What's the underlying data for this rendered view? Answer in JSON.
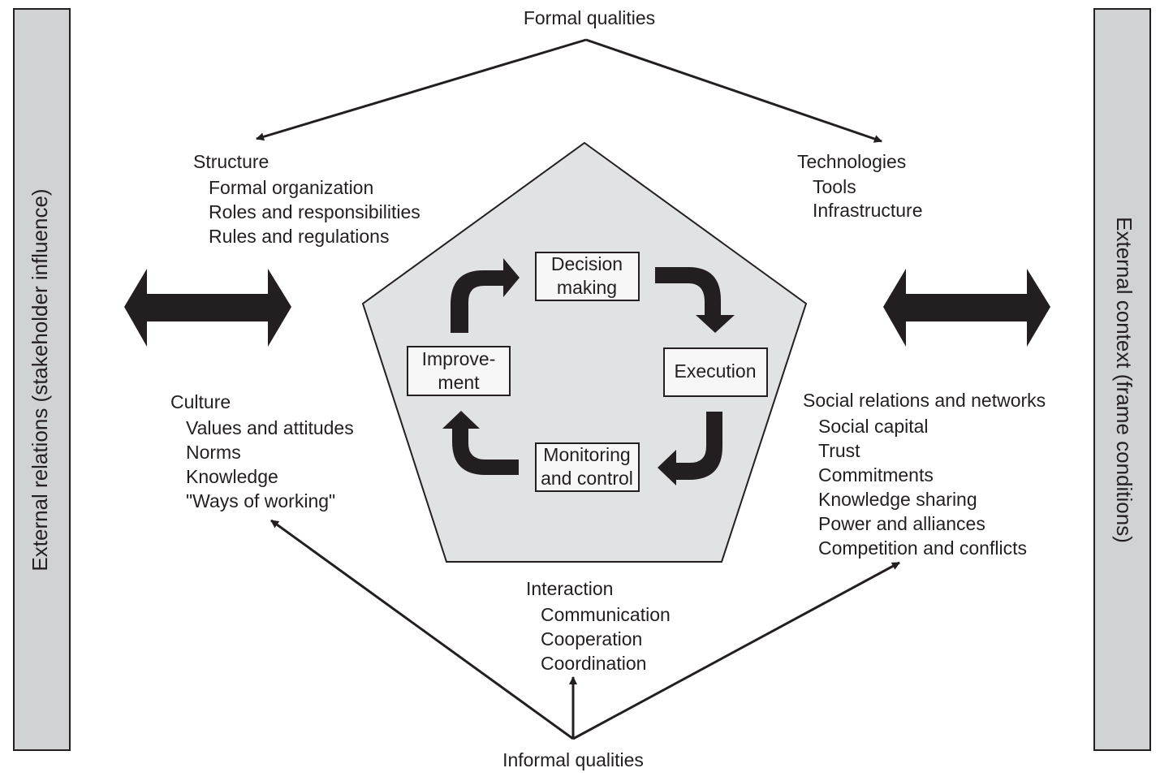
{
  "top": {
    "label": "Formal qualities"
  },
  "bottom": {
    "label": "Informal qualities"
  },
  "left_bar": {
    "label": "External relations (stakeholder influence)"
  },
  "right_bar": {
    "label": "External context (frame conditions)"
  },
  "groups": {
    "structure": {
      "title": "Structure",
      "items": [
        "Formal organization",
        "Roles and responsibilities",
        "Rules and regulations"
      ]
    },
    "technologies": {
      "title": "Technologies",
      "items": [
        "Tools",
        "Infrastructure"
      ]
    },
    "culture": {
      "title": "Culture",
      "items": [
        "Values and attitudes",
        "Norms",
        "Knowledge",
        "\"Ways of working\""
      ]
    },
    "social": {
      "title": "Social relations and networks",
      "items": [
        "Social capital",
        "Trust",
        "Commitments",
        "Knowledge sharing",
        "Power and alliances",
        "Competition and conflicts"
      ]
    },
    "interaction": {
      "title": "Interaction",
      "items": [
        "Communication",
        "Cooperation",
        "Coordination"
      ]
    }
  },
  "cycle": {
    "decision": [
      "Decision",
      "making"
    ],
    "execution": [
      "Execution"
    ],
    "monitoring": [
      "Monitoring",
      "and control"
    ],
    "improvement": [
      "Improve-",
      "ment"
    ]
  },
  "colors": {
    "ink": "#231f20",
    "bar_fill": "#d1d2d4",
    "pentagon_fill": "#e1e2e4",
    "box_fill": "#f7f7f7"
  }
}
